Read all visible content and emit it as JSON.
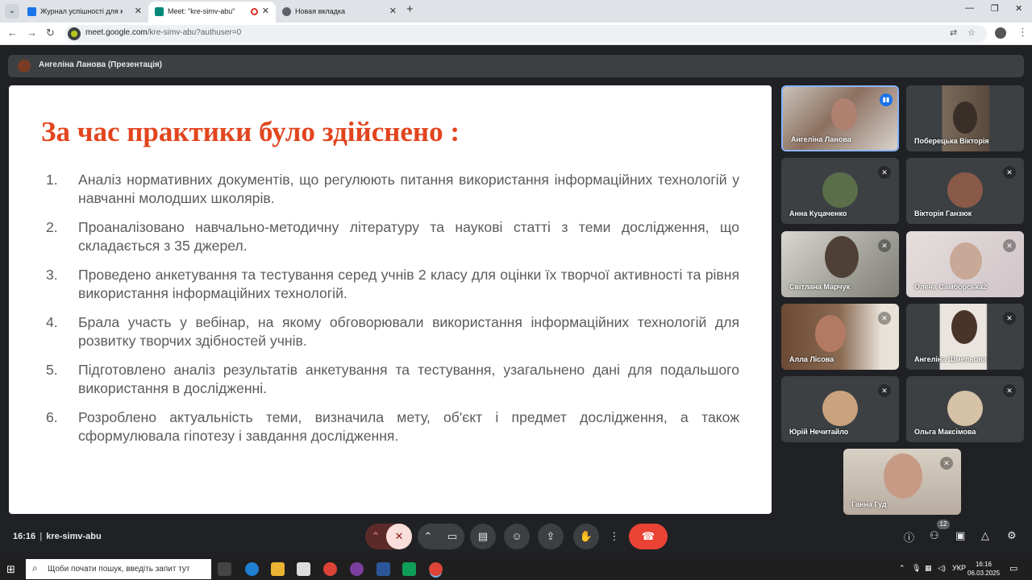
{
  "browser": {
    "tabs": [
      {
        "title": "Журнал успішності для курсу",
        "icon": "classroom-icon"
      },
      {
        "title": "Meet: \"kre-simv-abu\"",
        "icon": "meet-icon",
        "recording": true
      },
      {
        "title": "Новая вкладка",
        "icon": "chrome-icon"
      }
    ],
    "url_host": "meet.google.com",
    "url_path": "/kre-simv-abu?authuser=0"
  },
  "meet": {
    "presenter_label": "Ангеліна Ланова (Презентація)",
    "meeting_time": "16:16",
    "meeting_code": "kre-simv-abu",
    "participant_count": "12",
    "colors": {
      "end_call": "#ea4335",
      "mic_off": "#f28b82",
      "speaking": "#8ab4f8"
    }
  },
  "slide": {
    "title": "За час практики було здійснено :",
    "items": [
      {
        "num": "1.",
        "text": "Аналіз нормативних документів, що регулюють питання використання інформаційних технологій у навчанні молодших школярів."
      },
      {
        "num": "2.",
        "text": "Проаналізовано навчально-методичну літературу та наукові статті з теми дослідження, що складається з 35 джерел."
      },
      {
        "num": "3.",
        "text": "Проведено анкетування та тестування серед учнів 2 класу для оцінки їх творчої активності та рівня використання інформаційних технологій."
      },
      {
        "num": "4.",
        "text": "Брала участь у вебінар, на якому обговорювали використання інформаційних технологій для розвитку творчих здібностей учнів."
      },
      {
        "num": "5.",
        "text": "Підготовлено аналіз результатів анкетування та тестування, узагальнено дані для подальшого використання в дослідженні."
      },
      {
        "num": "6.",
        "text": "Розроблено актуальність теми, визначила мету, об'єкт і предмет дослідження, а також сформулювала гіпотезу і завдання дослідження."
      }
    ]
  },
  "participants": [
    {
      "name": "Ангеліна Ланова",
      "speaking": true
    },
    {
      "name": "Поберецька Вікторія",
      "muted": false
    },
    {
      "name": "Анна Куцаченко",
      "muted": true
    },
    {
      "name": "Вікторія Ганзюк",
      "muted": true
    },
    {
      "name": "Світлана Марчук",
      "muted": true
    },
    {
      "name": "Олена Самборська2",
      "muted": true
    },
    {
      "name": "Алла Лісова",
      "muted": true
    },
    {
      "name": "Ангеліна Шмельова",
      "muted": true
    },
    {
      "name": "Юрій Нечитайло",
      "muted": true
    },
    {
      "name": "Ольга Максімова",
      "muted": true
    },
    {
      "name": "Ганна Гуд",
      "muted": true
    }
  ],
  "taskbar": {
    "search_placeholder": "Щоби почати пошук, введіть запит тут",
    "language": "УКР",
    "time": "16:16",
    "date": "06.03.2025"
  }
}
